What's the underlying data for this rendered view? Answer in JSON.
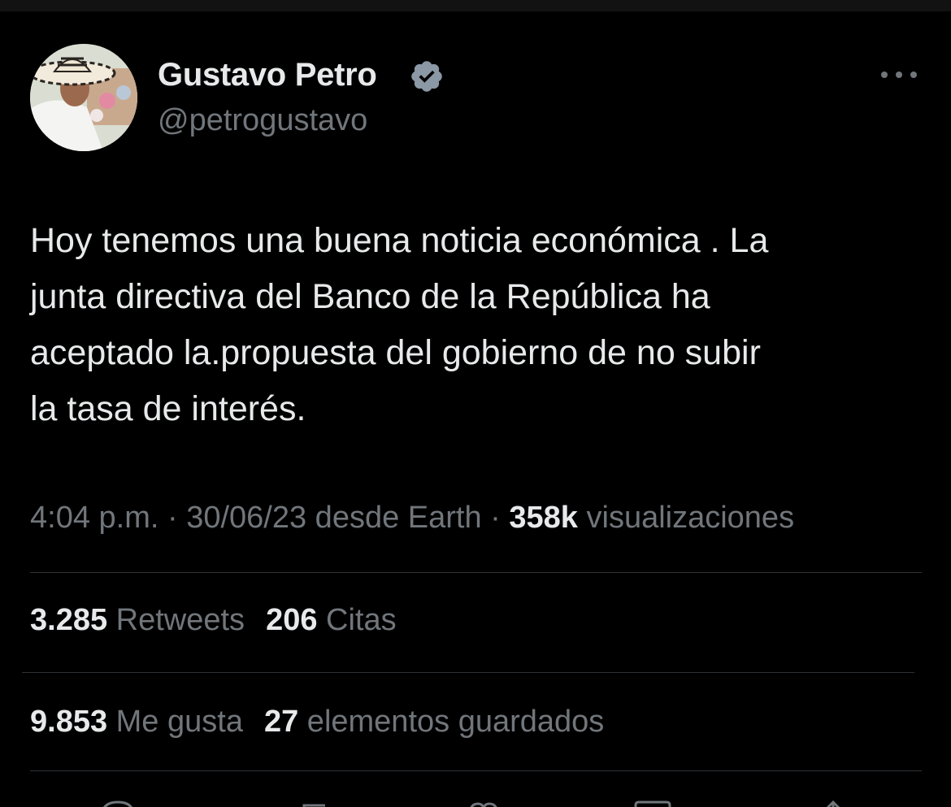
{
  "author": {
    "display_name": "Gustavo Petro",
    "handle": "@petrogustavo",
    "verified": true
  },
  "tweet": {
    "lines": [
      "Hoy tenemos una buena noticia económica . La",
      "junta directiva del Banco de la República ha",
      "aceptado la.propuesta del gobierno de no subir",
      "la tasa de interés."
    ]
  },
  "meta": {
    "time": "4:04 p.m.",
    "sep1": " · ",
    "date": "30/06/23",
    "source": " desde Earth",
    "sep2": " · ",
    "views_count": "358k",
    "views_label": " visualizaciones"
  },
  "stats": {
    "retweets_count": "3.285",
    "retweets_label": " Retweets",
    "quotes_count": "206",
    "quotes_label": " Citas",
    "likes_count": "9.853",
    "likes_label": " Me gusta",
    "bookmarks_count": "27",
    "bookmarks_label": " elementos guardados"
  },
  "icons": {
    "verified": "verified-badge-icon",
    "more": "more-options-icon",
    "reply": "reply-icon",
    "retweet": "retweet-icon",
    "like": "like-icon",
    "bookmark": "bookmark-icon",
    "share": "share-icon"
  },
  "colors": {
    "background": "#000000",
    "primary_text": "#e7e9ea",
    "secondary_text": "#71767b",
    "divider": "#2f3336"
  }
}
